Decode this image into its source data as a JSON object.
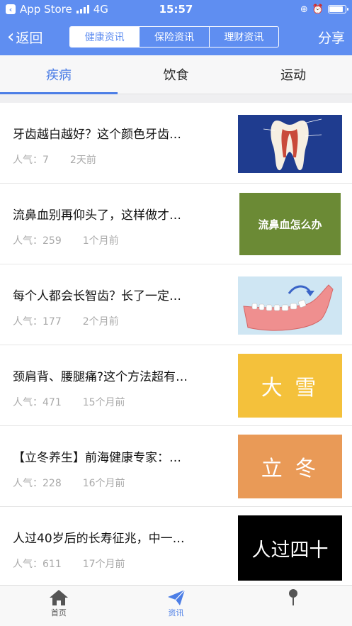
{
  "status": {
    "carrier_app": "App Store",
    "network": "4G",
    "time": "15:57"
  },
  "nav": {
    "back_label": "返回",
    "segments": [
      "健康资讯",
      "保险资讯",
      "理财资讯"
    ],
    "selected_segment": 0,
    "share_label": "分享"
  },
  "tabs": [
    "疾病",
    "饮食",
    "运动"
  ],
  "selected_tab": 0,
  "articles": [
    {
      "title": "牙齿越白越好？这个颜色牙齿…",
      "popularity_label": "人气：7",
      "time": "2天前",
      "thumb_text": "",
      "thumb": "tooth-diagram"
    },
    {
      "title": "流鼻血别再仰头了，这样做才…",
      "popularity_label": "人气：259",
      "time": "1个月前",
      "thumb_text": "流鼻血怎么办",
      "thumb": "green-banner"
    },
    {
      "title": "每个人都会长智齿？长了一定…",
      "popularity_label": "人气：177",
      "time": "2个月前",
      "thumb_text": "",
      "thumb": "jaw-diagram"
    },
    {
      "title": "颈肩背、腰腿痛?这个方法超有…",
      "popularity_label": "人气：471",
      "time": "15个月前",
      "thumb_text": "大 雪",
      "thumb": "yellow-banner"
    },
    {
      "title": "【立冬养生】前海健康专家：…",
      "popularity_label": "人气：228",
      "time": "16个月前",
      "thumb_text": "立 冬",
      "thumb": "orange-banner"
    },
    {
      "title": "人过40岁后的长寿征兆，中一…",
      "popularity_label": "人气：611",
      "time": "17个月前",
      "thumb_text": "人过四十",
      "thumb": "black-banner"
    }
  ],
  "tabbar": [
    {
      "label": "首页",
      "icon": "home-icon"
    },
    {
      "label": "资讯",
      "icon": "paper-plane-icon"
    },
    {
      "label": "",
      "icon": "person-icon"
    }
  ],
  "colors": {
    "accent": "#5f8ef1",
    "tab_accent": "#4c7ee6"
  }
}
